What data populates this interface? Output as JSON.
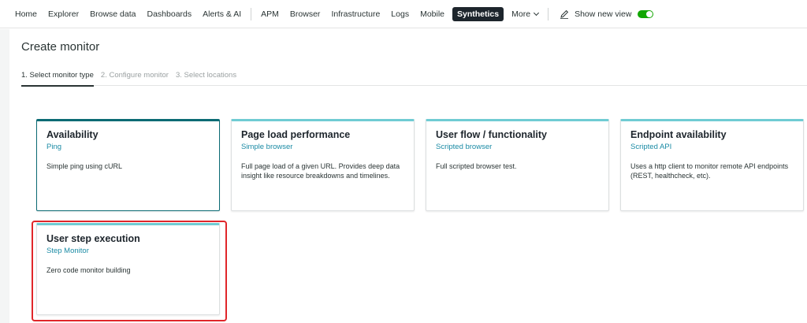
{
  "nav": {
    "items": [
      "Home",
      "Explorer",
      "Browse data",
      "Dashboards",
      "Alerts & AI"
    ],
    "items2": [
      "APM",
      "Browser",
      "Infrastructure",
      "Logs",
      "Mobile"
    ],
    "active": "Synthetics",
    "more": "More",
    "show_new_view": "Show new view"
  },
  "page": {
    "title": "Create monitor",
    "steps": [
      "1. Select monitor type",
      "2. Configure monitor",
      "3. Select locations"
    ]
  },
  "cards": [
    {
      "title": "Availability",
      "subtitle": "Ping",
      "description": "Simple ping using cURL"
    },
    {
      "title": "Page load performance",
      "subtitle": "Simple browser",
      "description": "Full page load of a given URL. Provides deep data insight like resource breakdowns and timelines."
    },
    {
      "title": "User flow / functionality",
      "subtitle": "Scripted browser",
      "description": "Full scripted browser test."
    },
    {
      "title": "Endpoint availability",
      "subtitle": "Scripted API",
      "description": "Uses a http client to monitor remote API endpoints (REST, healthcheck, etc)."
    },
    {
      "title": "User step execution",
      "subtitle": "Step Monitor",
      "description": "Zero code monitor building"
    }
  ],
  "colors": {
    "accent": "#70ccd3",
    "selected": "#0b6b74",
    "toggle_on": "#11a600",
    "highlight": "#e0262a"
  }
}
